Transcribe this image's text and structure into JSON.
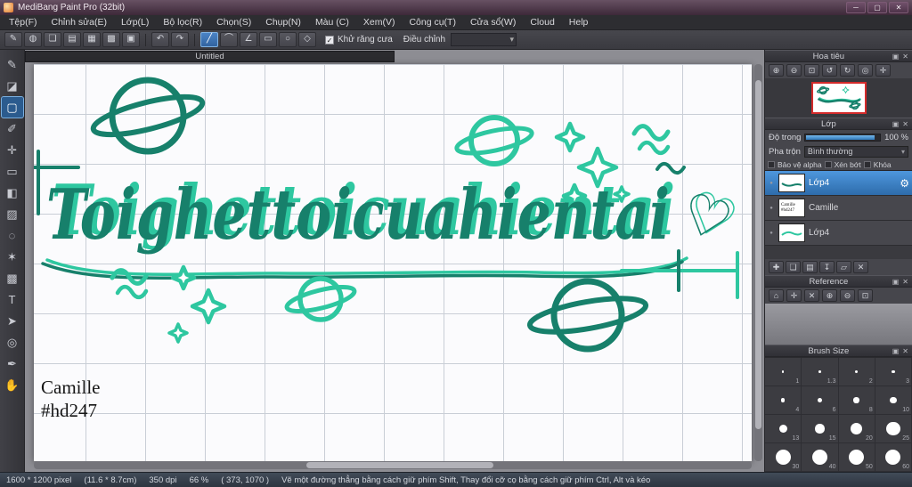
{
  "window": {
    "title": "MediBang Paint Pro (32bit)"
  },
  "colors": {
    "dark_teal": "#17806b",
    "light_teal": "#2ec7a0",
    "selection_blue": "#3f87cf",
    "titlebar_purple": "#4e3449"
  },
  "icons": {
    "minimize": "─",
    "maximize": "▢",
    "close": "✕",
    "brush": "✎",
    "export": "◍",
    "chat": "❏",
    "palette": "▤",
    "doc": "▦",
    "grid": "▩",
    "material": "▣",
    "undo": "↶",
    "redo": "↷",
    "line": "╱",
    "curve": "⌒",
    "polyline": "∠",
    "rect": "▭",
    "ellipse": "○",
    "polygon": "◇",
    "check": "✓",
    "dd_arrow": "▾",
    "zoom_in": "⊕",
    "zoom_out": "⊖",
    "zoom_fit": "⊡",
    "rotate_ccw": "↺",
    "rotate_cw": "↻",
    "reset": "◎",
    "crosshair": "✛",
    "panel_dock": "▣",
    "panel_close": "✕",
    "home": "⌂",
    "clear": "✕",
    "layer_add": "✚",
    "layer_dup": "❏",
    "layer_merge": "▤",
    "layer_down": "↧",
    "layer_folder": "▱",
    "layer_del": "✕",
    "gear": "⚙",
    "eye_dot": "●"
  },
  "menu": {
    "items": [
      "Tệp(F)",
      "Chỉnh sửa(E)",
      "Lớp(L)",
      "Bộ lọc(R)",
      "Chọn(S)",
      "Chụp(N)",
      "Màu (C)",
      "Xem(V)",
      "Công cụ(T)",
      "Cửa sổ(W)",
      "Cloud",
      "Help"
    ]
  },
  "toolbar": {
    "antialias_label": "Khử răng cưa",
    "adjust_label": "Điều chỉnh"
  },
  "tools": [
    {
      "name": "brush-tool",
      "glyph": "✎"
    },
    {
      "name": "eraser-tool",
      "glyph": "◪"
    },
    {
      "name": "select-rect-tool",
      "glyph": "▢",
      "selected": true
    },
    {
      "name": "pen-tool",
      "glyph": "✐"
    },
    {
      "name": "move-tool",
      "glyph": "✛"
    },
    {
      "name": "shape-select-tool",
      "glyph": "▭"
    },
    {
      "name": "bucket-tool",
      "glyph": "◧"
    },
    {
      "name": "gradient-tool",
      "glyph": "▨"
    },
    {
      "name": "lasso-tool",
      "glyph": "◌"
    },
    {
      "name": "magic-wand-tool",
      "glyph": "✶"
    },
    {
      "name": "pattern-tool",
      "glyph": "▩"
    },
    {
      "name": "text-tool",
      "glyph": "T"
    },
    {
      "name": "pointer-tool",
      "glyph": "➤"
    },
    {
      "name": "zoom-tool",
      "glyph": "◎"
    },
    {
      "name": "eyedropper-tool",
      "glyph": "✒"
    },
    {
      "name": "hand-tool",
      "glyph": "✋"
    }
  ],
  "canvas": {
    "tab": "Untitled",
    "artwork": {
      "main_text": "Toighettoicuahientai",
      "heart": "♡",
      "signature_line1": "Camille",
      "signature_line2": "#hd247"
    }
  },
  "panels": {
    "navigator": {
      "title": "Hoa tiêu"
    },
    "layers": {
      "title": "Lớp",
      "opacity_label": "Độ trong",
      "opacity_value": "100 %",
      "blend_label": "Pha trộn",
      "blend_value": "Bình thường",
      "check_alpha": "Bảo vệ alpha",
      "check_clip": "Xén bớt",
      "check_lock": "Khóa",
      "items": [
        {
          "name": "Lớp4",
          "selected": true
        },
        {
          "name": "Camille",
          "thumb1": "Camille",
          "thumb2": "#hd247"
        },
        {
          "name": "Lớp4"
        }
      ]
    },
    "reference": {
      "title": "Reference"
    },
    "brush": {
      "title": "Brush Size",
      "sizes": [
        "1",
        "1.3",
        "2",
        "3",
        "4",
        "6",
        "8",
        "10",
        "13",
        "15",
        "20",
        "25",
        "30",
        "40",
        "50",
        "60"
      ]
    }
  },
  "statusbar": {
    "segments": [
      "1600 * 1200 pixel",
      "(11.6 * 8.7cm)",
      "350 dpi",
      "66 %",
      "( 373, 1070 )",
      "Vẽ một đường thẳng bằng cách giữ phím Shift, Thay đổi cỡ cọ bằng cách giữ phím Ctrl, Alt và kéo"
    ]
  }
}
